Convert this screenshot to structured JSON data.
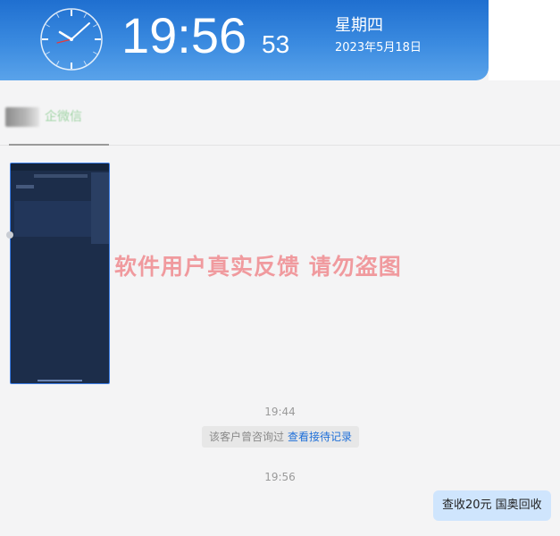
{
  "clock": {
    "time": "19:56",
    "seconds": "53",
    "weekday": "星期四",
    "date": "2023年5月18日"
  },
  "header": {
    "platform_tag": "企微信"
  },
  "watermark": "软件用户真实反馈  请勿盗图",
  "messages": {
    "timestamp_1": "19:44",
    "notice_text": "该客户曾咨询过",
    "notice_link": "查看接待记录",
    "timestamp_2": "19:56",
    "outgoing_text": "查收20元  国奥回收"
  },
  "colors": {
    "banner_blue": "#1f6fd0",
    "bubble_out": "#cfe5fd",
    "link": "#1e6fd9",
    "watermark": "#f09a9e"
  }
}
